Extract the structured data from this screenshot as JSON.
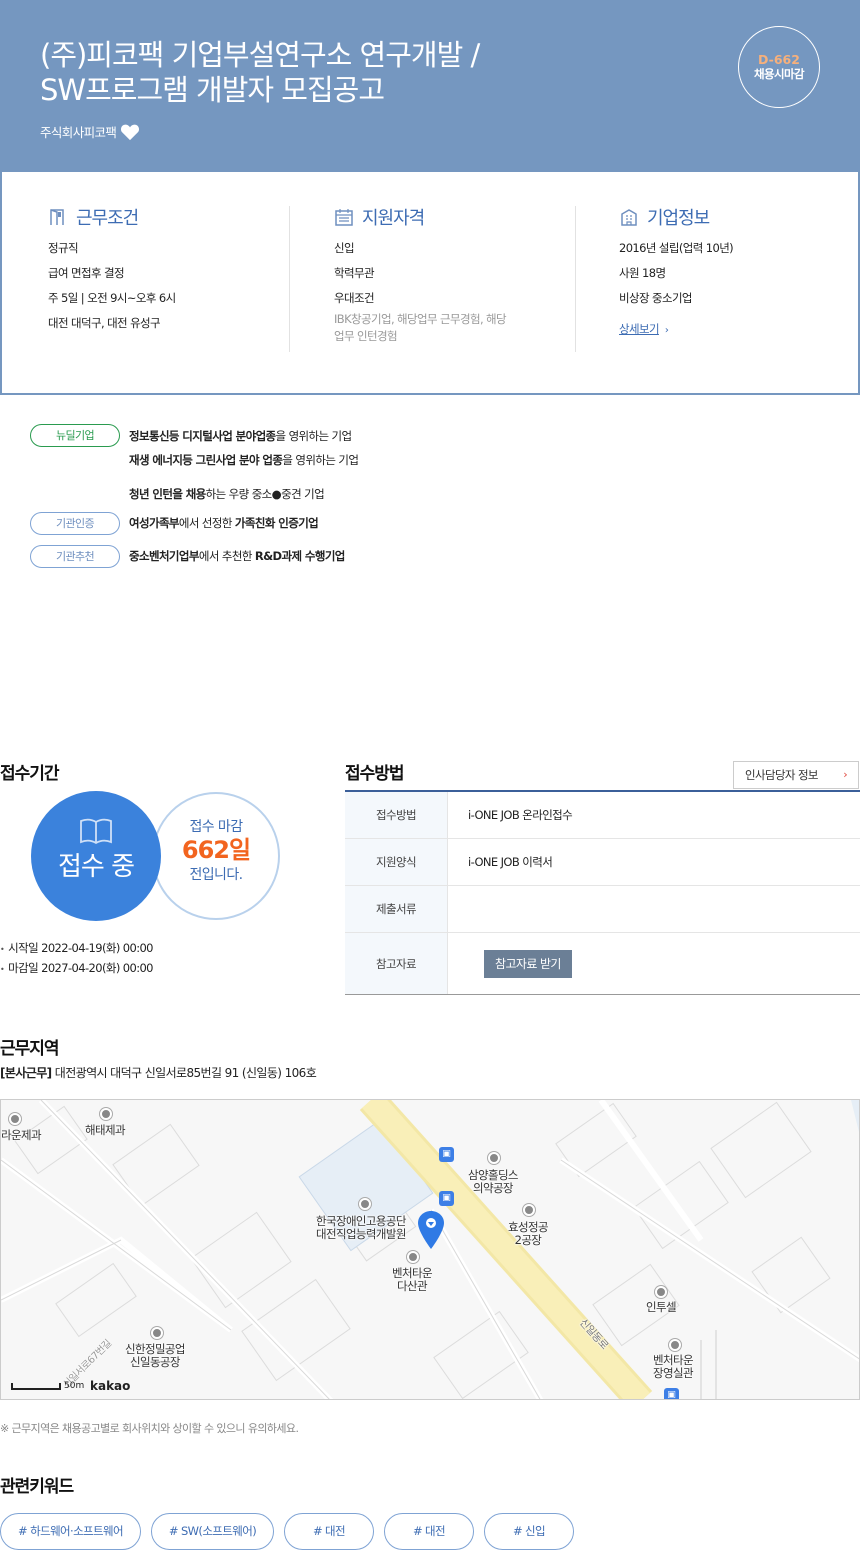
{
  "header": {
    "title_line1": "(주)피코팩 기업부설연구소 연구개발 /",
    "title_line2": "SW프로그램 개발자 모집공고",
    "company": "주식회사피코팩",
    "dday_num": "D-662",
    "dday_label": "채용시마감"
  },
  "summary": {
    "work": {
      "title": "근무조건",
      "lines": [
        "정규직",
        "급여 면접후 결정",
        "주 5일 | 오전 9시~오후 6시",
        "대전 대덕구, 대전 유성구"
      ]
    },
    "qual": {
      "title": "지원자격",
      "lines": [
        "신입",
        "학력무관",
        "우대조건"
      ],
      "sub": "IBK창공기업, 해당업무 근무경험, 해당업무 인턴경험"
    },
    "company": {
      "title": "기업정보",
      "lines": [
        "2016년 설립(업력 10년)",
        "사원 18명",
        "비상장 중소기업"
      ],
      "more": "상세보기",
      "more_chevron": "›"
    }
  },
  "tags": [
    {
      "pill": "뉴딜기업",
      "color": "green"
    },
    {
      "pill": "기관인증",
      "color": "blue"
    },
    {
      "pill": "기관추천",
      "color": "blue"
    }
  ],
  "tag_text": {
    "t1a_b1": "정보통신등 디지털사업 분야업종",
    "t1a_r": "을 영위하는 기업",
    "t1b_b1": "재생 에너지등 그린사업 분야 업종",
    "t1b_r": "을 영위하는 기업",
    "t1c_b1": "청년 인턴을 채용",
    "t1c_r": "하는 우량 중소●중견 기업",
    "t2_b1": "여성가족부",
    "t2_m": "에서 선정한 ",
    "t2_b2": "가족친화 인증기업",
    "t3_b1": "중소벤처기업부",
    "t3_m": "에서 추천한 ",
    "t3_b2": "R&D과제 수행기업"
  },
  "period": {
    "title": "접수기간",
    "state": "접수 중",
    "close_label": "접수 마감",
    "close_days": "662일",
    "close_suffix": "전입니다.",
    "start": "시작일 2022-04-19(화) 00:00",
    "end": "마감일 2027-04-20(화) 00:00"
  },
  "apply": {
    "title": "접수방법",
    "hr_button": "인사담당자 정보",
    "hr_chevron": "›",
    "rows": [
      {
        "k": "접수방법",
        "v": "i-ONE JOB 온라인접수"
      },
      {
        "k": "지원양식",
        "v": "i-ONE JOB 이력서"
      },
      {
        "k": "제출서류",
        "v": ""
      },
      {
        "k": "참고자료",
        "v": ""
      }
    ],
    "ref_button": "참고자료 받기"
  },
  "location": {
    "title": "근무지역",
    "tag": "[본사근무]",
    "address": "대전광역시 대덕구 신일서로85번길 91 (신일동) 106호",
    "note": "※ 근무지역은 채용공고별로 회사위치와 상이할 수 있으니 유의하세요.",
    "map_labels": {
      "l1": "라운제과",
      "l2": "해태제과",
      "l3a": "삼양홀딩스",
      "l3b": "의약공장",
      "l4a": "한국장애인고용공단",
      "l4b": "대전직업능력개발원",
      "l5a": "효성정공",
      "l5b": "2공장",
      "l6a": "벤처타운",
      "l6b": "다산관",
      "l7": "인투셀",
      "l8a": "신한정밀공업",
      "l8b": "신일동공장",
      "l9a": "벤처타운",
      "l9b": "장영실관",
      "road1": "신일동로",
      "road2": "신일서로67번길"
    },
    "scale": "50m",
    "kakao": "kakao"
  },
  "keywords": {
    "title": "관련키워드",
    "items": [
      "# 하드웨어·소프트웨어",
      "# SW(소프트웨어)",
      "# 대전",
      "# 대전",
      "# 신입"
    ]
  },
  "colors": {
    "header_bg": "#7597c0",
    "accent": "#3d6cb3",
    "orange": "#f2641f",
    "green": "#2a9b4f"
  }
}
